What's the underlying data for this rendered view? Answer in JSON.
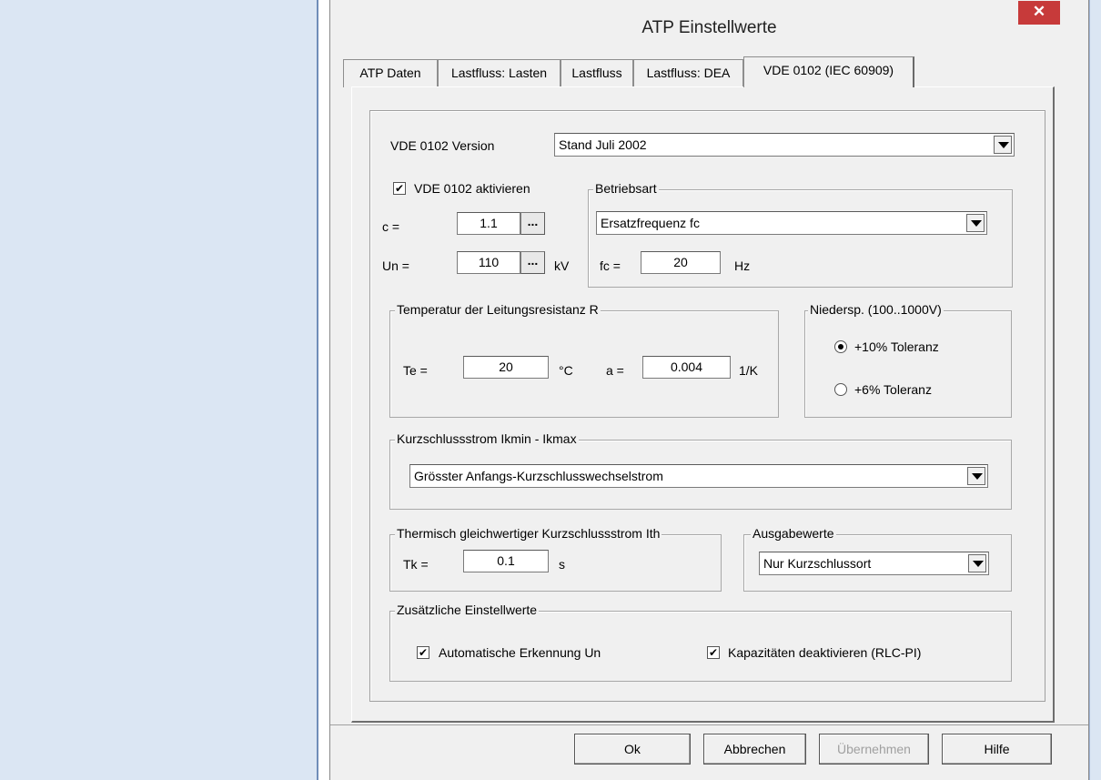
{
  "window": {
    "title": "ATP Einstellwerte",
    "close_glyph": "✕"
  },
  "tabs": [
    {
      "label": "ATP Daten"
    },
    {
      "label": "Lastfluss: Lasten"
    },
    {
      "label": "Lastfluss"
    },
    {
      "label": "Lastfluss: DEA"
    },
    {
      "label": "VDE 0102 (IEC 60909)"
    }
  ],
  "active_tab": "VDE 0102 (IEC 60909)",
  "version": {
    "label": "VDE 0102 Version",
    "value": "Stand Juli 2002"
  },
  "activate": {
    "label": "VDE 0102 aktivieren",
    "checked": true
  },
  "c": {
    "label": "c =",
    "value": "1.1",
    "button": "..."
  },
  "un": {
    "label": "Un =",
    "value": "110",
    "button": "...",
    "unit": "kV"
  },
  "betriebsart": {
    "title": "Betriebsart",
    "mode": "Ersatzfrequenz fc",
    "fc_label": "fc =",
    "fc_value": "20",
    "fc_unit": "Hz"
  },
  "temperatur": {
    "title": "Temperatur der Leitungsresistanz R",
    "te_label": "Te =",
    "te_value": "20",
    "te_unit": "°C",
    "a_label": "a =",
    "a_value": "0.004",
    "a_unit": "1/K"
  },
  "niedersp": {
    "title": "Niedersp. (100..1000V)",
    "options": [
      {
        "label": "+10% Toleranz",
        "selected": true
      },
      {
        "label": "+6% Toleranz",
        "selected": false
      }
    ]
  },
  "kurzschluss": {
    "title": "Kurzschlussstrom Ikmin - Ikmax",
    "value": "Grösster Anfangs-Kurzschlusswechselstrom"
  },
  "thermisch": {
    "title": "Thermisch gleichwertiger Kurzschlussstrom Ith",
    "tk_label": "Tk =",
    "tk_value": "0.1",
    "tk_unit": "s"
  },
  "ausgabe": {
    "title": "Ausgabewerte",
    "value": "Nur Kurzschlussort"
  },
  "zusatz": {
    "title": "Zusätzliche Einstellwerte",
    "auto_un": {
      "label": "Automatische Erkennung Un",
      "checked": true
    },
    "kapazitaeten": {
      "label": "Kapazitäten deaktivieren (RLC-PI)",
      "checked": true
    }
  },
  "check_glyph": "✔",
  "buttons": {
    "ok": "Ok",
    "cancel": "Abbrechen",
    "apply": "Übernehmen",
    "help": "Hilfe"
  }
}
